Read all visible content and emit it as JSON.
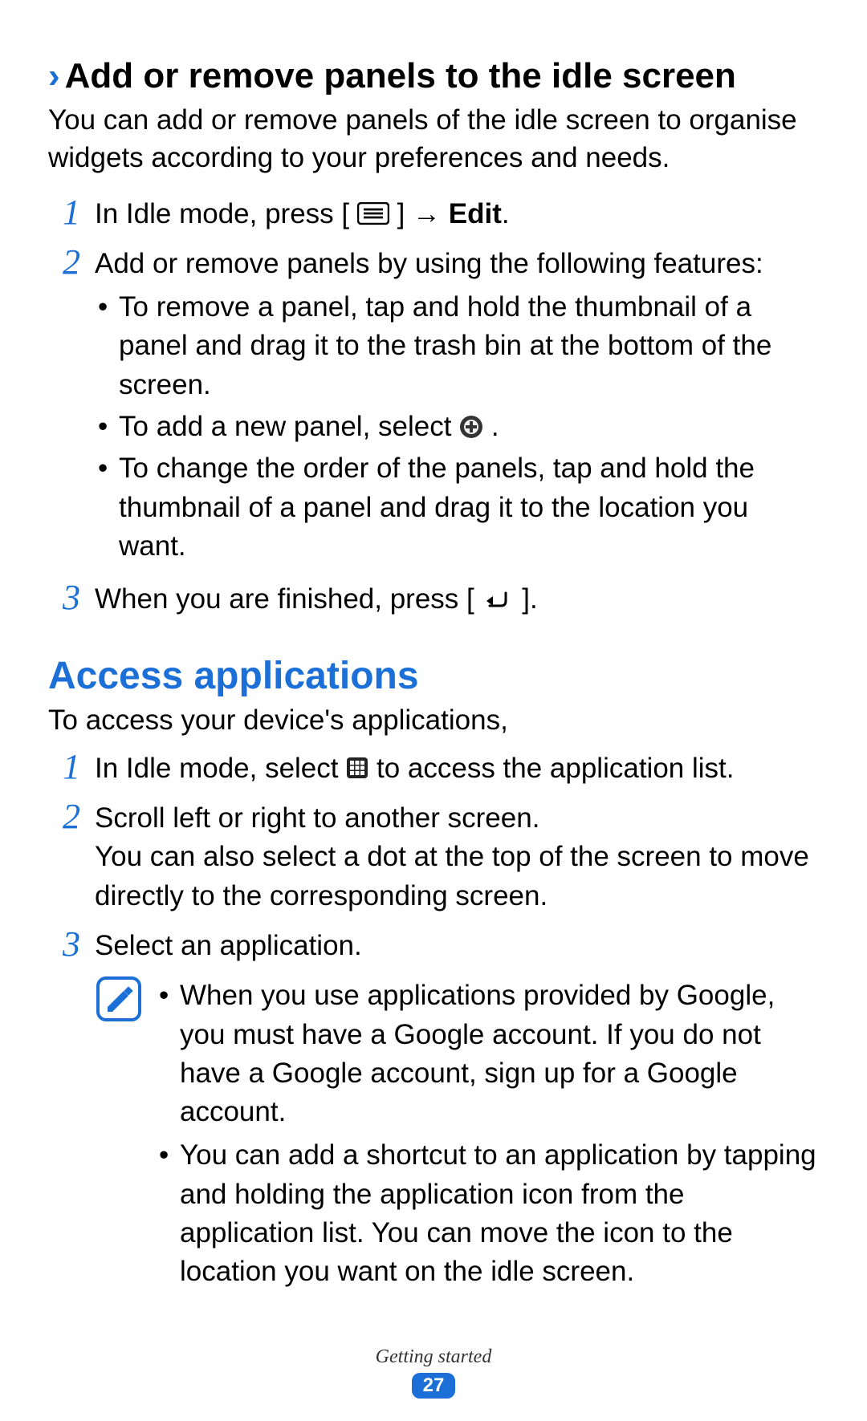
{
  "section1": {
    "heading": "Add or remove panels to the idle screen",
    "intro": "You can add or remove panels of the idle screen to organise widgets according to your preferences and needs.",
    "steps": {
      "s1_a": "In Idle mode, press [",
      "s1_b": "] → ",
      "s1_bold": "Edit",
      "s1_c": ".",
      "s2": "Add or remove panels by using the following features:",
      "b1": "To remove a panel, tap and hold the thumbnail of a panel and drag it to the trash bin at the bottom of the screen.",
      "b2_a": "To add a new panel, select ",
      "b2_b": ".",
      "b3": "To change the order of the panels, tap and hold the thumbnail of a panel and drag it to the location you want.",
      "s3_a": "When you are finished, press [",
      "s3_b": "]."
    }
  },
  "section2": {
    "title": "Access applications",
    "intro": "To access your device's applications,",
    "steps": {
      "s1_a": "In Idle mode, select ",
      "s1_b": " to access the application list.",
      "s2": "Scroll left or right to another screen.\nYou can also select a dot at the top of the screen to move directly to the corresponding screen.",
      "s3": "Select an application."
    },
    "note": {
      "n1": "When you use applications provided by Google, you must have a Google account. If you do not have a Google account, sign up for a Google account.",
      "n2": "You can add a shortcut to an application by tapping and holding the application icon from the application list. You can move the icon to the location you want on the idle screen."
    }
  },
  "footer": {
    "chapter": "Getting started",
    "page": "27"
  },
  "nums": {
    "one": "1",
    "two": "2",
    "three": "3"
  }
}
